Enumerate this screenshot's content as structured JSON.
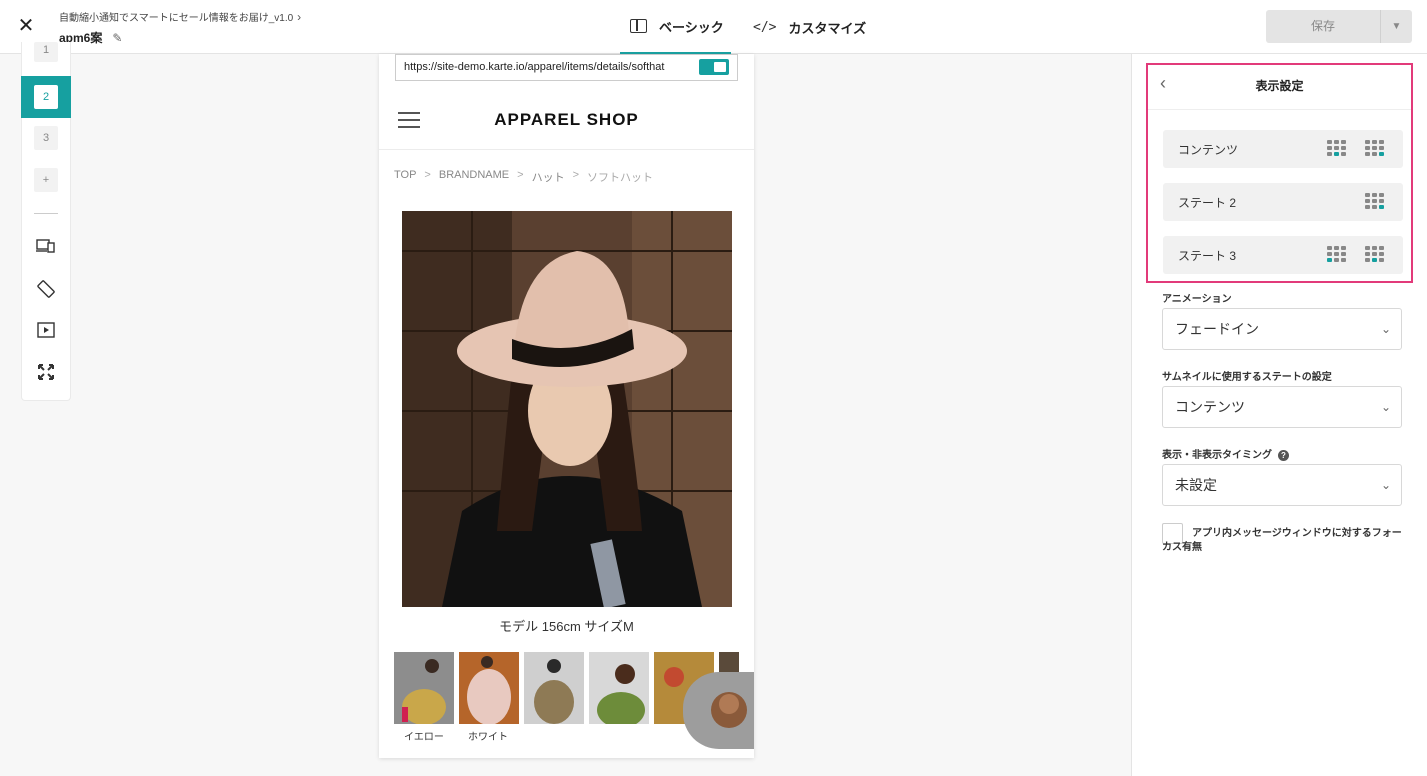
{
  "topbar": {
    "campaign_title": "自動縮小通知でスマートにセール情報をお届け_v1.0",
    "variant_name": "apm6案",
    "tab_basic": "ベーシック",
    "tab_customize": "カスタマイズ",
    "save_label": "保存"
  },
  "rail": {
    "states": [
      "1",
      "2",
      "3"
    ],
    "active_state": "2",
    "add_label": "+"
  },
  "preview": {
    "url": "https://site-demo.karte.io/apparel/items/details/softhat",
    "shop_title": "APPAREL SHOP",
    "breadcrumbs": [
      "TOP",
      "BRANDNAME",
      "ハット",
      "ソフトハット"
    ],
    "caption": "モデル 156cm サイズM",
    "thumb_labels": [
      "イエロー",
      "ホワイト"
    ]
  },
  "panel": {
    "display_title": "表示設定",
    "state_rows": [
      "コンテンツ",
      "ステート 2",
      "ステート 3"
    ],
    "animation_label": "アニメーション",
    "animation_value": "フェードイン",
    "thumbnail_label": "サムネイルに使用するステートの設定",
    "thumbnail_value": "コンテンツ",
    "timing_label": "表示・非表示タイミング",
    "timing_value": "未設定",
    "focus_label": "アプリ内メッセージウィンドウに対するフォーカス有無"
  },
  "colors": {
    "accent": "#16a0a0",
    "highlight_border": "#e23a7a"
  }
}
